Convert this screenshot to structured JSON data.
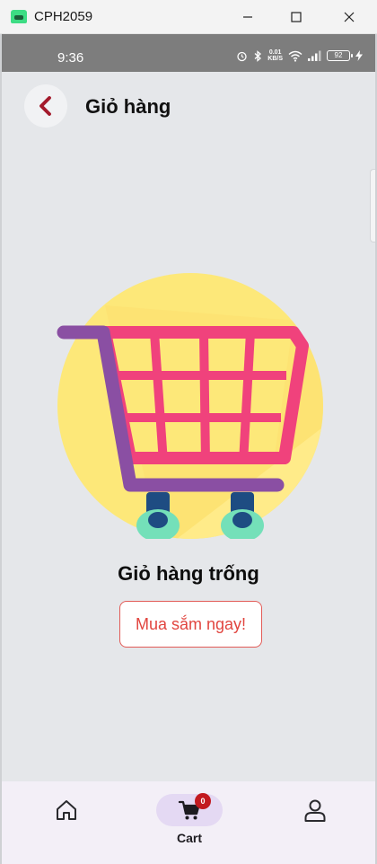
{
  "window": {
    "title": "CPH2059"
  },
  "status_bar": {
    "time": "9:36",
    "net_speed_value": "0.01",
    "net_speed_unit": "KB/S",
    "battery": "92"
  },
  "header": {
    "title": "Giỏ hàng"
  },
  "empty_state": {
    "title": "Giỏ hàng trống",
    "button_label": "Mua sắm ngay!"
  },
  "bottom_nav": {
    "items": [
      {
        "label": "",
        "icon": "home-icon"
      },
      {
        "label": "Cart",
        "icon": "cart-icon",
        "badge": "0",
        "active": true
      },
      {
        "label": "",
        "icon": "person-icon"
      }
    ]
  },
  "colors": {
    "accent_red": "#e1453f",
    "back_arrow": "#a3192b",
    "cart_pink": "#f0427c",
    "cart_handle": "#8a4fa3",
    "illustration_yellow": "#fde879",
    "active_nav_pill": "#e4d9f3",
    "badge": "#c21a1f"
  }
}
